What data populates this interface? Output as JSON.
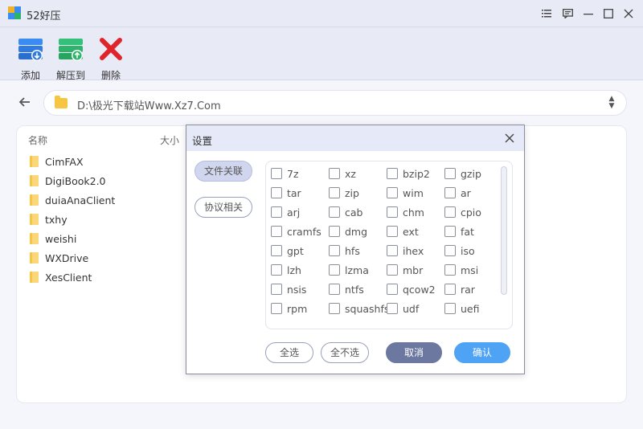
{
  "app": {
    "title": "52好压"
  },
  "toolbar": {
    "add_label": "添加",
    "extract_label": "解压到",
    "delete_label": "删除"
  },
  "path": {
    "value": "D:\\极光下载站Www.Xz7.Com"
  },
  "file_list": {
    "col_name": "名称",
    "col_size": "大小",
    "items": [
      "CimFAX",
      "DigiBook2.0",
      "duiaAnaClient",
      "txhy",
      "weishi",
      "WXDrive",
      "XesClient"
    ]
  },
  "dialog": {
    "title": "设置",
    "tab_file_assoc": "文件关联",
    "tab_protocol": "协议相关",
    "formats": [
      "7z",
      "xz",
      "bzip2",
      "gzip",
      "tar",
      "zip",
      "wim",
      "ar",
      "arj",
      "cab",
      "chm",
      "cpio",
      "cramfs",
      "dmg",
      "ext",
      "fat",
      "gpt",
      "hfs",
      "ihex",
      "iso",
      "lzh",
      "lzma",
      "mbr",
      "msi",
      "nsis",
      "ntfs",
      "qcow2",
      "rar",
      "rpm",
      "squashfs",
      "udf",
      "uefi"
    ],
    "select_all": "全选",
    "select_none": "全不选",
    "cancel": "取消",
    "ok": "确认"
  },
  "colors": {
    "accent_blue": "#4ea3f5",
    "cancel_gray": "#6c789f",
    "folder_yellow": "#f6c541",
    "delete_red": "#e0242b"
  }
}
